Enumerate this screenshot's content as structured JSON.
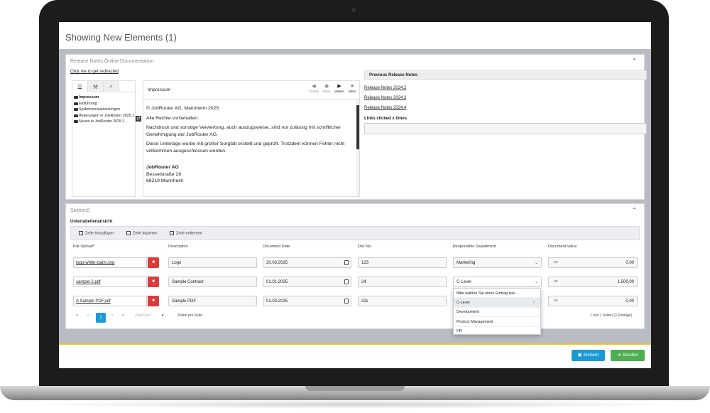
{
  "page": {
    "title": "Showing New Elements (1)"
  },
  "colors": {
    "primary": "#1a9ad6",
    "success": "#4caf50",
    "danger": "#dc3b3b",
    "accent": "#f3c623"
  },
  "section1": {
    "title": "Release Notes Online Documentation",
    "redirect_link": "Click me to get redirected",
    "help": {
      "tabs": [
        {
          "icon": "list-icon"
        },
        {
          "icon": "wrench-icon"
        },
        {
          "icon": "search-icon"
        }
      ],
      "tree": [
        {
          "label": "Impressum",
          "bold": true
        },
        {
          "label": "Einführung",
          "bold": false
        },
        {
          "label": "Systemvoraussetzungen",
          "bold": false
        },
        {
          "label": "Änderungen in JobRouter 2025.1",
          "bold": false
        },
        {
          "label": "Neues in JobRouter 2025.1",
          "bold": false
        }
      ],
      "viewer": {
        "title": "Impressum",
        "nav": {
          "back": "Zurück",
          "home": "Oben",
          "next": "Weiter",
          "more": "Mehr"
        },
        "lines": [
          "© JobRouter AG, Mannheim 2025",
          "Alle Rechte vorbehalten.",
          "Nachdruck und sonstige Verwertung, auch auszugsweise, sind nur zulässig mit schriftlicher Genehmigung der JobRouter AG.",
          "Diese Unterlage wurde mit großer Sorgfalt erstellt und geprüft. Trotzdem können Fehler nicht vollkommen ausgeschlossen werden."
        ],
        "company": "JobRouter AG",
        "street": "Besselstraße 26",
        "city": "68219 Mannheim"
      }
    },
    "previous": {
      "header": "Previous Release Notes",
      "links": [
        "Release Notes 2024.2",
        "Release Notes 2024.3",
        "Release Notes 2024.4"
      ],
      "clicks_label": "Links clicked x times",
      "clicks_value": ""
    }
  },
  "section2": {
    "title": "Sektion2",
    "subtable_title": "Untertabellenansicht",
    "toolbar": {
      "add": "Zeile hinzufügen",
      "copy": "Zeile kopieren",
      "remove": "Zeile entfernen"
    },
    "columns": [
      "File Upload*",
      "Description",
      "Document Date",
      "Doc No.",
      "Responsible Department",
      "Document Value"
    ],
    "rows": [
      {
        "file": "logo-white-claim.svg",
        "description": "Logo",
        "date": "20.03.2025",
        "doc_no": "123",
        "department": "Marketing",
        "value": "0,00"
      },
      {
        "file": "sample-2.pdf",
        "description": "Sample Contract",
        "date": "01.01.2025",
        "doc_no": "24",
        "department": "C-Level",
        "value": "1.500,00"
      },
      {
        "file": "A Sample PDF.pdf",
        "description": "Sample PDF",
        "date": "01.03.2025",
        "doc_no": "311",
        "department": "",
        "value": "0,00"
      }
    ],
    "number_icon": ".00",
    "pagination": {
      "first": "«",
      "prev": "‹",
      "page": "1",
      "next": "›",
      "last": "»",
      "per_page_placeholder": "Zeilen pro ...",
      "per_page_label": "Zeilen pro Seite",
      "summary": "1 von 1 Seiten (3 Einträge)"
    },
    "department_dropdown": {
      "options": [
        "Bitte wählen Sie einen Eintrag aus...",
        "C-Level",
        "Development",
        "Product Management",
        "HR"
      ],
      "selected": "C-Level"
    }
  },
  "footer": {
    "save": "Sichern",
    "send": "Senden"
  }
}
